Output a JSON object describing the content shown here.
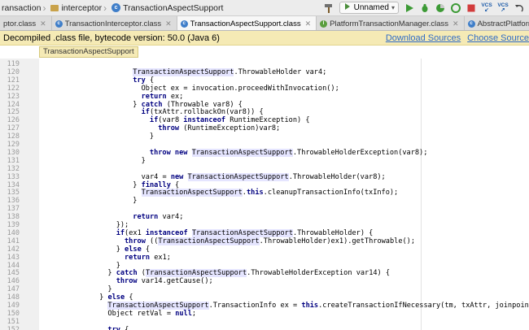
{
  "navbar": {
    "crumbs": [
      "ransaction",
      "interceptor",
      "TransactionAspectSupport"
    ],
    "run_config": "Unnamed"
  },
  "tabs": [
    {
      "label": "ptor.class",
      "active": false
    },
    {
      "label": "TransactionInterceptor.class",
      "active": false
    },
    {
      "label": "TransactionAspectSupport.class",
      "active": true
    },
    {
      "label": "PlatformTransactionManager.class",
      "active": false
    },
    {
      "label": "AbstractPlatformTransactionManager.class",
      "active": false
    }
  ],
  "banner": {
    "message": "Decompiled .class file, bytecode version: 50.0 (Java 6)",
    "download_link": "Download Sources",
    "choose_link": "Choose Source"
  },
  "crumb_hint": "TransactionAspectSupport",
  "code": {
    "lines": [
      {
        "n": "119",
        "indent": 0,
        "parts": []
      },
      {
        "n": "120",
        "indent": 11,
        "parts": [
          [
            "c",
            "TransactionAspectSupport"
          ],
          [
            "t",
            ".ThrowableHolder var4;"
          ]
        ]
      },
      {
        "n": "121",
        "indent": 11,
        "parts": [
          [
            "k",
            "try"
          ],
          [
            "t",
            " {"
          ]
        ]
      },
      {
        "n": "122",
        "indent": 12,
        "parts": [
          [
            "t",
            "Object ex = invocation.proceedWithInvocation();"
          ]
        ]
      },
      {
        "n": "123",
        "indent": 12,
        "parts": [
          [
            "k",
            "return"
          ],
          [
            "t",
            " ex;"
          ]
        ]
      },
      {
        "n": "124",
        "indent": 11,
        "parts": [
          [
            "t",
            "} "
          ],
          [
            "k",
            "catch"
          ],
          [
            "t",
            " (Throwable var8) {"
          ]
        ]
      },
      {
        "n": "125",
        "indent": 12,
        "parts": [
          [
            "k",
            "if"
          ],
          [
            "t",
            "(txAttr.rollbackOn(var8)) {"
          ]
        ]
      },
      {
        "n": "126",
        "indent": 13,
        "parts": [
          [
            "k",
            "if"
          ],
          [
            "t",
            "(var8 "
          ],
          [
            "k",
            "instanceof"
          ],
          [
            "t",
            " RuntimeException) {"
          ]
        ]
      },
      {
        "n": "127",
        "indent": 14,
        "parts": [
          [
            "k",
            "throw"
          ],
          [
            "t",
            " (RuntimeException)var8;"
          ]
        ]
      },
      {
        "n": "128",
        "indent": 13,
        "parts": [
          [
            "t",
            "}"
          ]
        ]
      },
      {
        "n": "129",
        "indent": 0,
        "parts": []
      },
      {
        "n": "130",
        "indent": 13,
        "parts": [
          [
            "k",
            "throw new"
          ],
          [
            "t",
            " "
          ],
          [
            "c",
            "TransactionAspectSupport"
          ],
          [
            "t",
            ".ThrowableHolderException(var8);"
          ]
        ]
      },
      {
        "n": "131",
        "indent": 12,
        "parts": [
          [
            "t",
            "}"
          ]
        ]
      },
      {
        "n": "132",
        "indent": 0,
        "parts": []
      },
      {
        "n": "133",
        "indent": 12,
        "parts": [
          [
            "t",
            "var4 = "
          ],
          [
            "k",
            "new"
          ],
          [
            "t",
            " "
          ],
          [
            "c",
            "TransactionAspectSupport"
          ],
          [
            "t",
            ".ThrowableHolder(var8);"
          ]
        ]
      },
      {
        "n": "134",
        "indent": 11,
        "parts": [
          [
            "t",
            "} "
          ],
          [
            "k",
            "finally"
          ],
          [
            "t",
            " {"
          ]
        ]
      },
      {
        "n": "135",
        "indent": 12,
        "parts": [
          [
            "c",
            "TransactionAspectSupport"
          ],
          [
            "t",
            "."
          ],
          [
            "k",
            "this"
          ],
          [
            "t",
            ".cleanupTransactionInfo(txInfo);"
          ]
        ]
      },
      {
        "n": "136",
        "indent": 11,
        "parts": [
          [
            "t",
            "}"
          ]
        ]
      },
      {
        "n": "137",
        "indent": 0,
        "parts": []
      },
      {
        "n": "138",
        "indent": 11,
        "parts": [
          [
            "k",
            "return"
          ],
          [
            "t",
            " var4;"
          ]
        ]
      },
      {
        "n": "139",
        "indent": 9,
        "parts": [
          [
            "t",
            "});"
          ]
        ]
      },
      {
        "n": "140",
        "indent": 9,
        "parts": [
          [
            "k",
            "if"
          ],
          [
            "t",
            "(ex1 "
          ],
          [
            "k",
            "instanceof"
          ],
          [
            "t",
            " "
          ],
          [
            "c",
            "TransactionAspectSupport"
          ],
          [
            "t",
            ".ThrowableHolder) {"
          ]
        ]
      },
      {
        "n": "141",
        "indent": 10,
        "parts": [
          [
            "k",
            "throw"
          ],
          [
            "t",
            " (("
          ],
          [
            "c",
            "TransactionAspectSupport"
          ],
          [
            "t",
            ".ThrowableHolder)ex1).getThrowable();"
          ]
        ]
      },
      {
        "n": "142",
        "indent": 9,
        "parts": [
          [
            "t",
            "} "
          ],
          [
            "k",
            "else"
          ],
          [
            "t",
            " {"
          ]
        ]
      },
      {
        "n": "143",
        "indent": 10,
        "parts": [
          [
            "k",
            "return"
          ],
          [
            "t",
            " ex1;"
          ]
        ]
      },
      {
        "n": "144",
        "indent": 9,
        "parts": [
          [
            "t",
            "}"
          ]
        ]
      },
      {
        "n": "145",
        "indent": 8,
        "parts": [
          [
            "t",
            "} "
          ],
          [
            "k",
            "catch"
          ],
          [
            "t",
            " ("
          ],
          [
            "c",
            "TransactionAspectSupport"
          ],
          [
            "t",
            ".ThrowableHolderException var14) {"
          ]
        ]
      },
      {
        "n": "146",
        "indent": 9,
        "parts": [
          [
            "k",
            "throw"
          ],
          [
            "t",
            " var14.getCause();"
          ]
        ]
      },
      {
        "n": "147",
        "indent": 8,
        "parts": [
          [
            "t",
            "}"
          ]
        ]
      },
      {
        "n": "148",
        "indent": 7,
        "parts": [
          [
            "t",
            "} "
          ],
          [
            "k",
            "else"
          ],
          [
            "t",
            " {"
          ]
        ]
      },
      {
        "n": "149",
        "indent": 8,
        "parts": [
          [
            "c",
            "TransactionAspectSupport"
          ],
          [
            "t",
            ".TransactionInfo ex = "
          ],
          [
            "k",
            "this"
          ],
          [
            "t",
            ".createTransactionIfNecessary(tm, txAttr, joinpointIdentification);"
          ]
        ]
      },
      {
        "n": "150",
        "indent": 8,
        "parts": [
          [
            "t",
            "Object retVal = "
          ],
          [
            "k",
            "null"
          ],
          [
            "t",
            ";"
          ]
        ]
      },
      {
        "n": "151",
        "indent": 0,
        "parts": []
      },
      {
        "n": "152",
        "indent": 8,
        "parts": [
          [
            "k",
            "try"
          ],
          [
            "t",
            " {"
          ]
        ]
      }
    ]
  },
  "colors": {
    "keyword": "#000080",
    "class_highlight": "#e5e5ff",
    "banner_bg": "#f5eab5",
    "link": "#2f6bc6"
  }
}
